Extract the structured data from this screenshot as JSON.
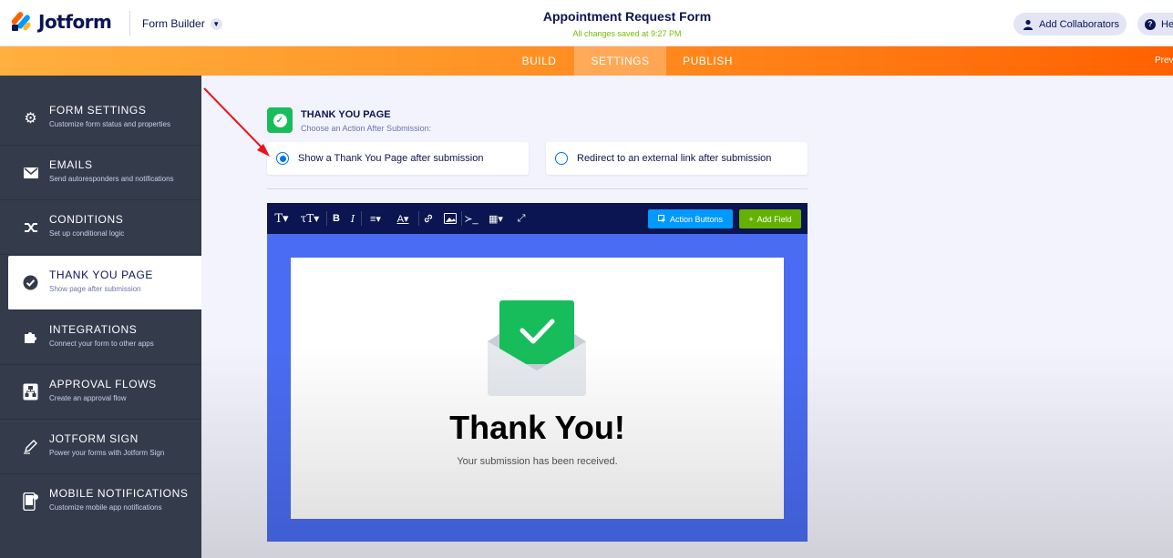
{
  "header": {
    "logo_text": "Jotform",
    "builder_label": "Form Builder",
    "form_title": "Appointment Request Form",
    "saved_status": "All changes saved at 9:27 PM",
    "collaborators_label": "Add Collaborators",
    "help_label": "Help"
  },
  "nav": {
    "tabs": [
      {
        "label": "BUILD"
      },
      {
        "label": "SETTINGS"
      },
      {
        "label": "PUBLISH"
      }
    ],
    "active_tab": "SETTINGS",
    "preview_label": "Preview"
  },
  "sidebar": {
    "items": [
      {
        "title": "FORM SETTINGS",
        "subtitle": "Customize form status and properties",
        "icon": "gear-icon"
      },
      {
        "title": "EMAILS",
        "subtitle": "Send autoresponders and notifications",
        "icon": "envelope-icon"
      },
      {
        "title": "CONDITIONS",
        "subtitle": "Set up conditional logic",
        "icon": "shuffle-icon"
      },
      {
        "title": "THANK YOU PAGE",
        "subtitle": "Show page after submission",
        "icon": "check-circle-icon"
      },
      {
        "title": "INTEGRATIONS",
        "subtitle": "Connect your form to other apps",
        "icon": "puzzle-icon"
      },
      {
        "title": "APPROVAL FLOWS",
        "subtitle": "Create an approval flow",
        "icon": "flow-icon"
      },
      {
        "title": "JOTFORM SIGN",
        "subtitle": "Power your forms with Jotform Sign",
        "icon": "pen-icon"
      },
      {
        "title": "MOBILE NOTIFICATIONS",
        "subtitle": "Customize mobile app notifications",
        "icon": "mobile-icon"
      }
    ],
    "active_item": "THANK YOU PAGE"
  },
  "panel": {
    "title": "THANK YOU PAGE",
    "subtitle": "Choose an Action After Submission:",
    "options": [
      {
        "label": "Show a Thank You Page after submission",
        "selected": true
      },
      {
        "label": "Redirect to an external link after submission",
        "selected": false
      }
    ]
  },
  "editor": {
    "action_buttons_label": "Action Buttons",
    "add_field_label": "Add Field"
  },
  "thankyou": {
    "heading": "Thank You!",
    "message": "Your submission has been received."
  },
  "colors": {
    "orange_start": "#ffb03f",
    "orange_end": "#ff6100",
    "sidebar_bg": "#343c4c",
    "navy": "#0a1551",
    "success_green": "#18bd5b",
    "canvas_blue": "#4a6cf2",
    "radio_blue": "#0075e3",
    "annotation_red": "#e8141b"
  }
}
